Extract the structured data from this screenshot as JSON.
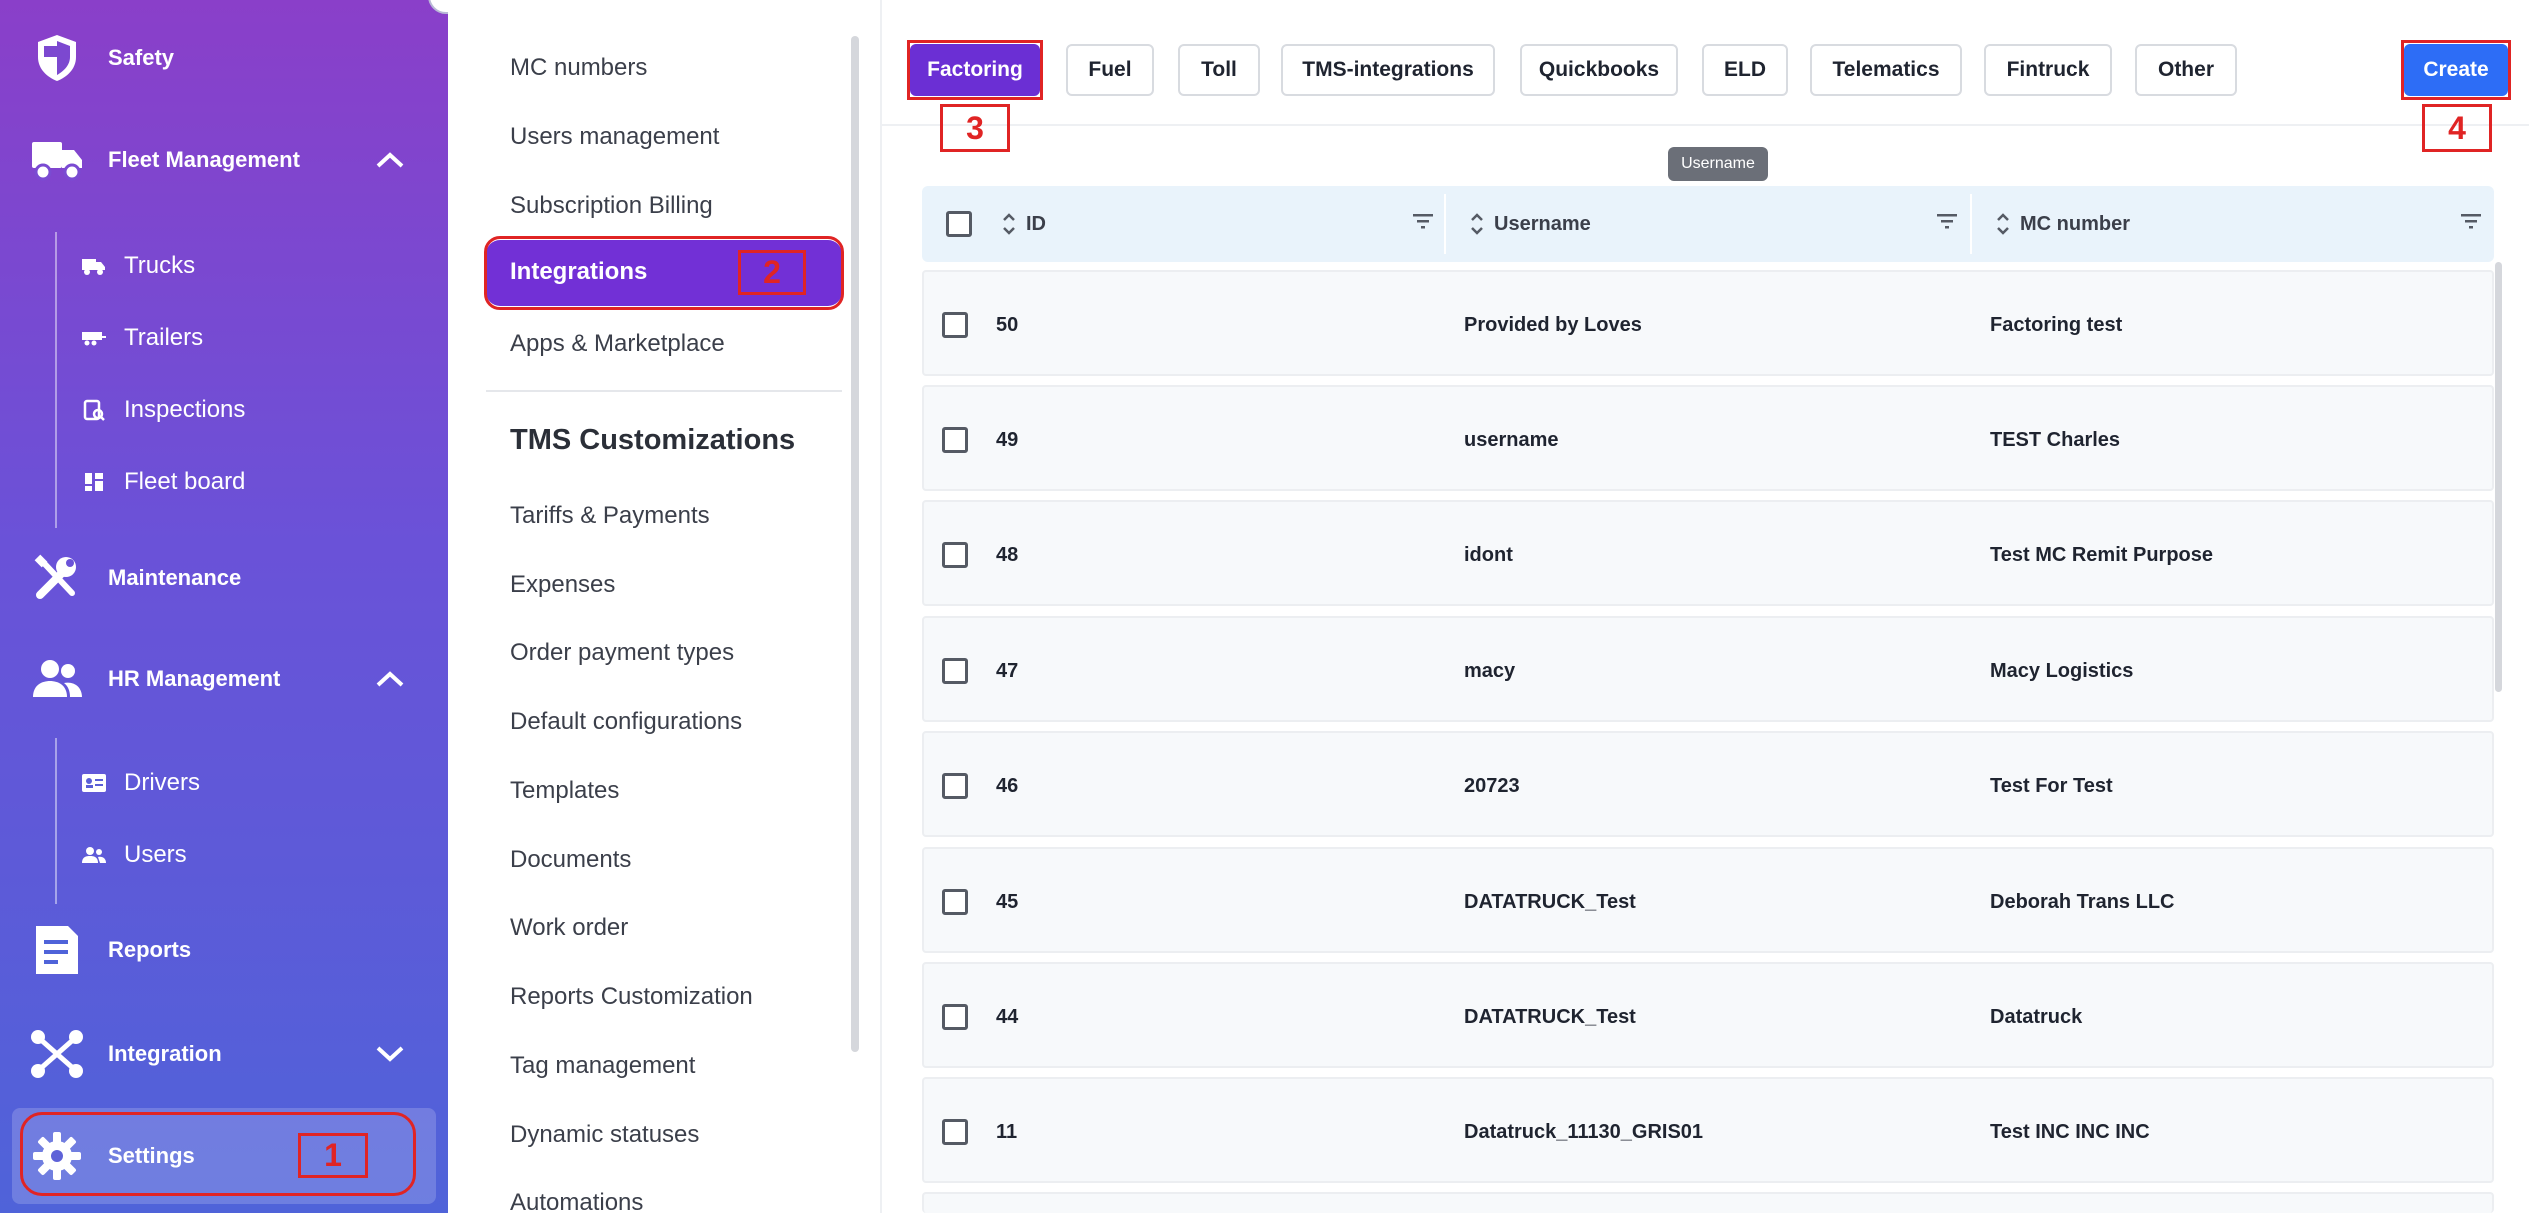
{
  "sidebar": {
    "items": [
      {
        "label": "Safety",
        "icon": "shield-icon"
      },
      {
        "label": "Fleet Management",
        "icon": "truck-icon",
        "expanded": true,
        "children": [
          {
            "label": "Trucks",
            "icon": "truck-small-icon"
          },
          {
            "label": "Trailers",
            "icon": "trailer-icon"
          },
          {
            "label": "Inspections",
            "icon": "inspection-icon"
          },
          {
            "label": "Fleet board",
            "icon": "board-icon"
          }
        ]
      },
      {
        "label": "Maintenance",
        "icon": "wrench-icon"
      },
      {
        "label": "HR Management",
        "icon": "people-icon",
        "expanded": true,
        "children": [
          {
            "label": "Drivers",
            "icon": "id-card-icon"
          },
          {
            "label": "Users",
            "icon": "users-icon"
          }
        ]
      },
      {
        "label": "Reports",
        "icon": "report-icon"
      },
      {
        "label": "Integration",
        "icon": "integration-icon",
        "expanded": false
      },
      {
        "label": "Settings",
        "icon": "gear-icon",
        "active": true
      }
    ]
  },
  "settings_menu": {
    "items": [
      "MC numbers",
      "Users management",
      "Subscription Billing",
      "Integrations",
      "Apps & Marketplace"
    ],
    "active": "Integrations",
    "section_title": "TMS Customizations",
    "section_items": [
      "Tariffs & Payments",
      "Expenses",
      "Order payment types",
      "Default configurations",
      "Templates",
      "Documents",
      "Work order",
      "Reports Customization",
      "Tag management",
      "Dynamic statuses",
      "Automations"
    ]
  },
  "tabs": [
    {
      "label": "Factoring",
      "active": true
    },
    {
      "label": "Fuel"
    },
    {
      "label": "Toll"
    },
    {
      "label": "TMS-integrations"
    },
    {
      "label": "Quickbooks"
    },
    {
      "label": "ELD"
    },
    {
      "label": "Telematics"
    },
    {
      "label": "Fintruck"
    },
    {
      "label": "Other"
    }
  ],
  "create_label": "Create",
  "tooltip": "Username",
  "table": {
    "columns": [
      "ID",
      "Username",
      "MC number"
    ],
    "rows": [
      {
        "id": "50",
        "username": "Provided by Loves",
        "mc": "Factoring test"
      },
      {
        "id": "49",
        "username": "username",
        "mc": "TEST Charles"
      },
      {
        "id": "48",
        "username": "idont",
        "mc": "Test MC Remit Purpose"
      },
      {
        "id": "47",
        "username": "macy",
        "mc": "Macy Logistics"
      },
      {
        "id": "46",
        "username": "20723",
        "mc": "Test For Test"
      },
      {
        "id": "45",
        "username": "DATATRUCK_Test",
        "mc": "Deborah Trans LLC"
      },
      {
        "id": "44",
        "username": "DATATRUCK_Test",
        "mc": "Datatruck"
      },
      {
        "id": "11",
        "username": "Datatruck_11130_GRIS01",
        "mc": "Test INC INC INC"
      }
    ]
  },
  "annotations": [
    "1",
    "2",
    "3",
    "4"
  ],
  "colors": {
    "accent": "#6b2fd4",
    "create": "#2d6df6",
    "annotation": "#e02424"
  }
}
